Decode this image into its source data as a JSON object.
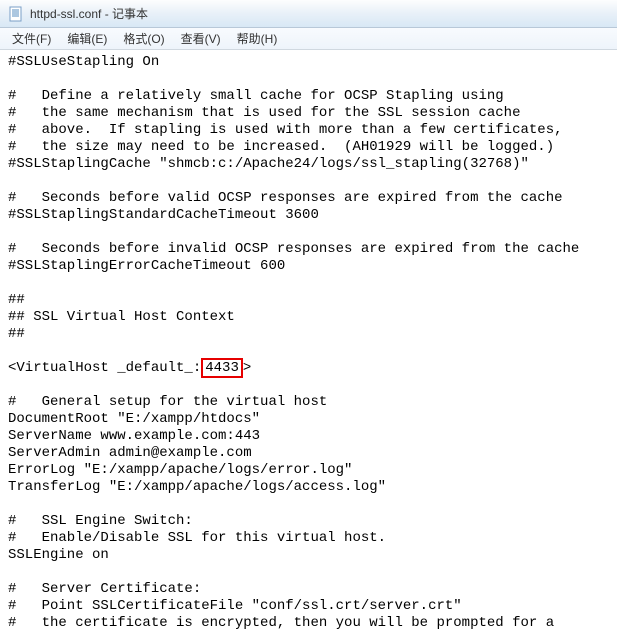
{
  "window": {
    "title": "httpd-ssl.conf - 记事本"
  },
  "menu": {
    "file": "文件(F)",
    "edit": "编辑(E)",
    "format": "格式(O)",
    "view": "查看(V)",
    "help": "帮助(H)"
  },
  "content": {
    "line01": "#SSLUseStapling On",
    "line02": "",
    "line03": "#   Define a relatively small cache for OCSP Stapling using",
    "line04": "#   the same mechanism that is used for the SSL session cache",
    "line05": "#   above.  If stapling is used with more than a few certificates,",
    "line06": "#   the size may need to be increased.  (AH01929 will be logged.)",
    "line07": "#SSLStaplingCache \"shmcb:c:/Apache24/logs/ssl_stapling(32768)\"",
    "line08": "",
    "line09": "#   Seconds before valid OCSP responses are expired from the cache",
    "line10": "#SSLStaplingStandardCacheTimeout 3600",
    "line11": "",
    "line12": "#   Seconds before invalid OCSP responses are expired from the cache",
    "line13": "#SSLStaplingErrorCacheTimeout 600",
    "line14": "",
    "line15": "##",
    "line16": "## SSL Virtual Host Context",
    "line17": "##",
    "line18": "",
    "line19a": "<VirtualHost _default_:",
    "line19h": "4433",
    "line19b": ">",
    "line20": "",
    "line21": "#   General setup for the virtual host",
    "line22": "DocumentRoot \"E:/xampp/htdocs\"",
    "line23": "ServerName www.example.com:443",
    "line24": "ServerAdmin admin@example.com",
    "line25": "ErrorLog \"E:/xampp/apache/logs/error.log\"",
    "line26": "TransferLog \"E:/xampp/apache/logs/access.log\"",
    "line27": "",
    "line28": "#   SSL Engine Switch:",
    "line29": "#   Enable/Disable SSL for this virtual host.",
    "line30": "SSLEngine on",
    "line31": "",
    "line32": "#   Server Certificate:",
    "line33": "#   Point SSLCertificateFile \"conf/ssl.crt/server.crt\"",
    "line34": "#   the certificate is encrypted, then you will be prompted for a"
  }
}
